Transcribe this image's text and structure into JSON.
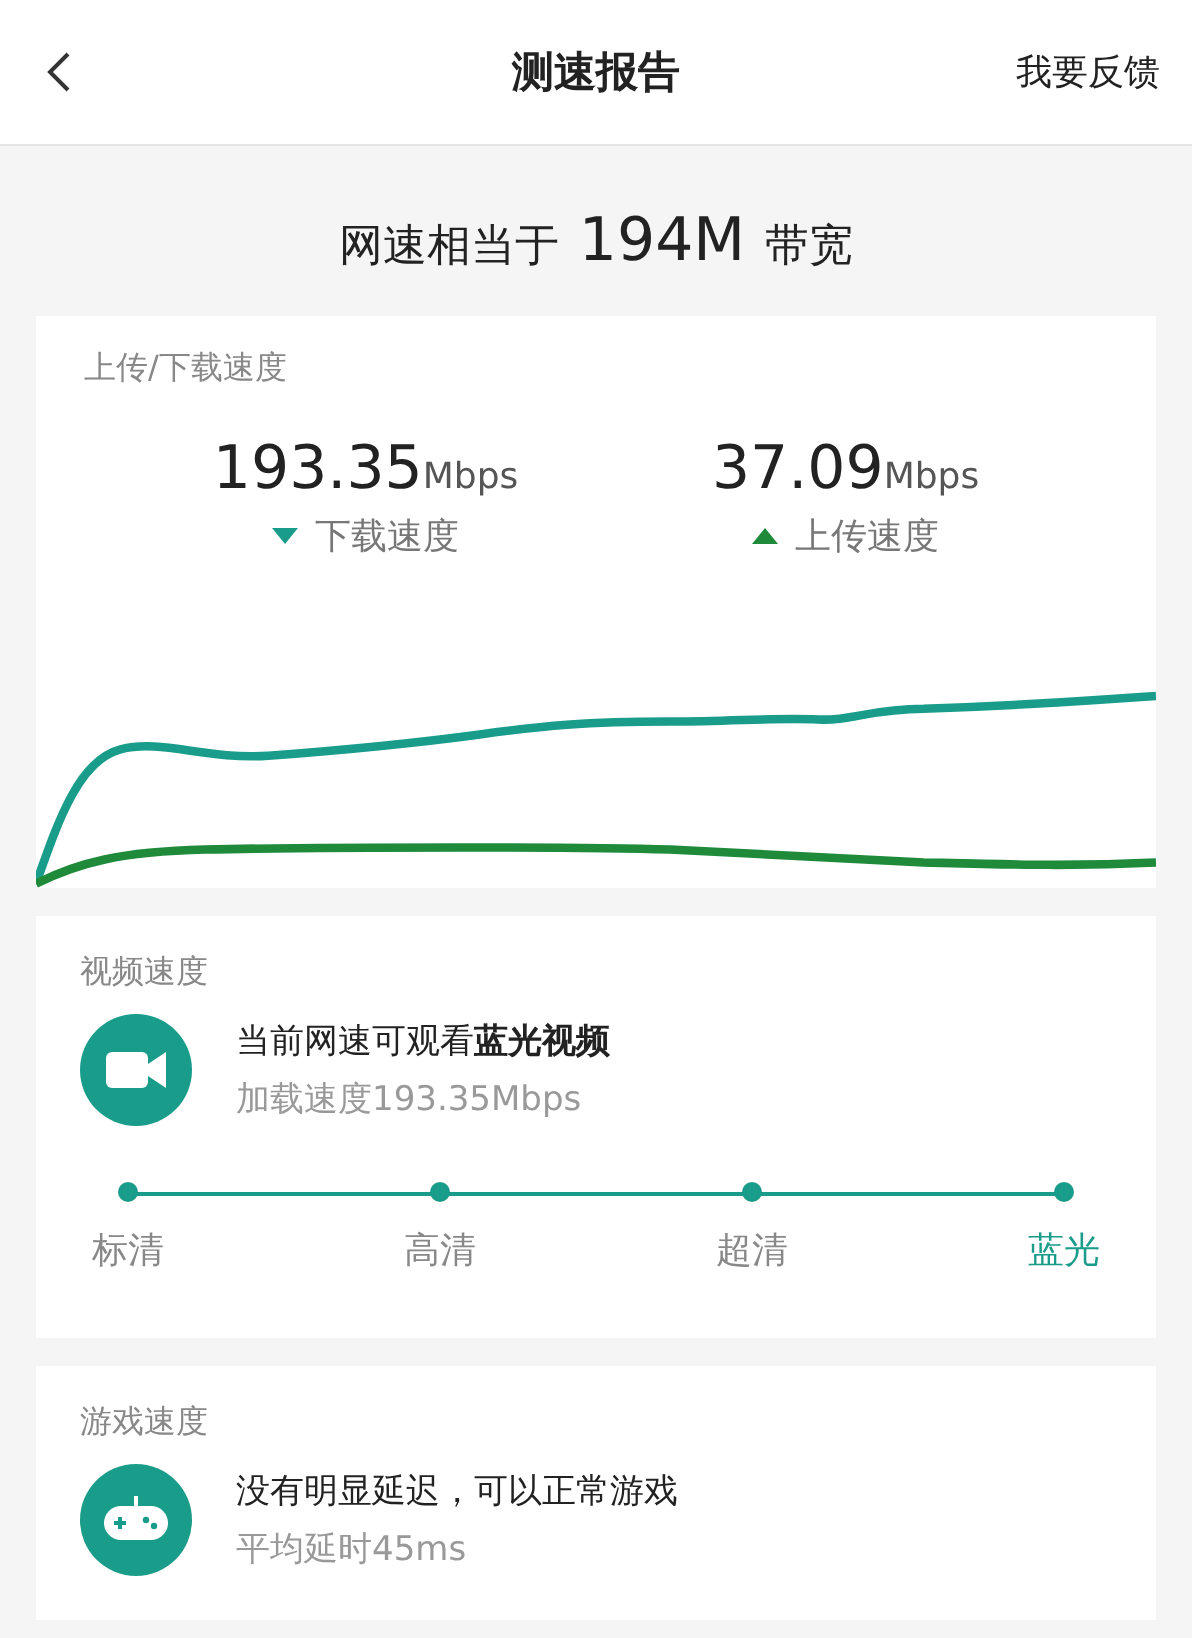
{
  "header": {
    "title": "测速报告",
    "action": "我要反馈"
  },
  "summary": {
    "prefix": "网速相当于",
    "value": "194M",
    "suffix": "带宽"
  },
  "speed_card": {
    "title": "上传/下载速度",
    "readings": [
      {
        "kind": "download",
        "value": "193.35",
        "unit": "Mbps",
        "label": "下载速度"
      },
      {
        "kind": "upload",
        "value": "37.09",
        "unit": "Mbps",
        "label": "上传速度"
      }
    ]
  },
  "video_card": {
    "title": "视频速度",
    "message": "当前网速可观看**蓝光视频**",
    "detail": "加载速度193.35Mbps",
    "levels": [
      {
        "label": "标清",
        "selected": false
      },
      {
        "label": "高清",
        "selected": false
      },
      {
        "label": "超清",
        "selected": false
      },
      {
        "label": "蓝光",
        "selected": true
      }
    ]
  },
  "game_card": {
    "title": "游戏速度",
    "message": "没有明显延迟，可以正常游戏",
    "detail": "平均延时45ms"
  }
}
